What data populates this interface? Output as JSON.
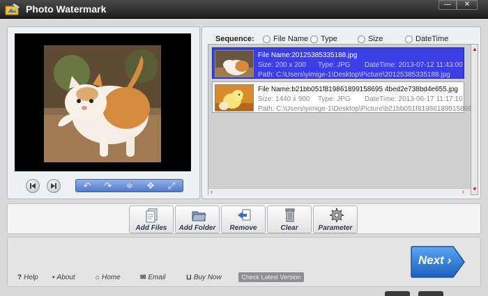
{
  "window": {
    "title": "Photo Watermark",
    "minimize_glyph": "—",
    "close_glyph": "✕"
  },
  "preview": {
    "controls": [
      "prev-icon",
      "next-icon"
    ],
    "tools": [
      "↶",
      "↷",
      "≑",
      "✥",
      "⤢"
    ]
  },
  "sequence": {
    "label": "Sequence:",
    "options": [
      "File Name",
      "Type",
      "Size",
      "DateTime"
    ]
  },
  "files": [
    {
      "name_label": "File Name:20125385335188.jpg",
      "size_label": "Size: 200 x 200",
      "type_label": "Type: JPG",
      "date_label": "DateTime: 2013-07-12 11:43:00",
      "path_label": "Path: C:\\Users\\yimige-1\\Desktop\\Picture\\20125385335188.jpg",
      "selected": true
    },
    {
      "name_label": "File Name:b21bb051f819861899158695 4bed2e738bd4e655.jpg",
      "size_label": "Size: 1440 x 900",
      "type_label": "Type: JPG",
      "date_label": "DateTime: 2013-06-17 11:17:10",
      "path_label": "Path: C:\\Users\\yimige-1\\Desktop\\Picture\\b21bb051f81986189915869...",
      "selected": false
    }
  ],
  "actions": {
    "add_files": "Add Files",
    "add_folder": "Add Folder",
    "remove": "Remove",
    "clear": "Clear",
    "parameter": "Parameter"
  },
  "footer": {
    "help": "Help",
    "about": "About",
    "home": "Home",
    "email": "Email",
    "buy_now": "Buy Now",
    "check_latest": "Check Latest Version",
    "next": "Next ›"
  },
  "colors": {
    "selection": "#3b3fe3",
    "next_button": "#2f78d8",
    "scroll_arrow": "#c81a1a"
  }
}
